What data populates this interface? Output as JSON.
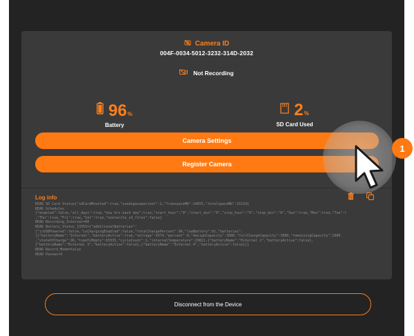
{
  "device": {
    "camera_id_label": "Camera ID",
    "camera_id_value": "004F-0034-5012-3232-314D-2032",
    "recording_status": "Not Recording"
  },
  "stats": {
    "battery": {
      "value": "96",
      "unit": "%",
      "label": "Battery"
    },
    "sd_card": {
      "value": "2",
      "unit": "%",
      "label": "SD Card Used"
    }
  },
  "buttons": {
    "camera_settings": "Camera Settings",
    "register_camera": "Register Camera",
    "disconnect": "Disconnect from the Device"
  },
  "log": {
    "title": "Log info",
    "lines": [
      "READ SD Card Status{\"sdCardMounted\":true,\"usedspacepercent\":2,\"freespaceMb\":14655,\"totalspaceMb\":15114}",
      "READ Schedules",
      "{\"enabled\":false,\"all_days\":true,\"how hrs each day\":true,\"start_hour\":\"0\",\"start_min\":\"0\",\"stop_hour\":\"0\",\"stop_min\":\"0\",\"Sun\":true,\"Mon\":true,\"Tue\":true,\"Wed\":true",
      ",\"Thu\":true,\"Fri\":true,\"Sat\":true,\"overwrite_sd_files\":false}",
      "READ Recording_Interval=60",
      "READ Battery_Status_13355={\"additionalBatteries\":",
      "[\"isUSBPowered\":false,\"isChargingEnabled\":false,\"totalChargePercent\":96,\"lowBattery\":0},\"batteries\":",
      "[{\"batteryName\":\"Internal\",\"batteryActive\":true,\"voltage\":4374,\"percent\":0,\"designCapacity\":3080,\"fullChargeCapacity\":3080,\"remainingCapacity\":2906",
      ",\"stateOfCharge\":96,\"timeToEmpty\":65535,\"cycleCount\":1,\"internalTemperature\":2982},{\"batteryName\":\"External 2\",\"batteryActive\":false},",
      "{\"batteryName\":\"External 3\",\"batteryActive\":false},{\"batteryName\":\"External 4\",\"batteryActive\":false}]}",
      "READ Record_Mode=false",
      "READ Password"
    ]
  },
  "overlay": {
    "step_number": "1"
  },
  "icons": {
    "camera": "camera-off-icon",
    "not_recording": "video-off-icon",
    "battery": "battery-icon",
    "sd_card": "sd-card-icon",
    "delete": "trash-icon",
    "copy": "copy-icon",
    "cursor": "mouse-pointer-icon"
  },
  "colors": {
    "accent": "#ff7a12",
    "background": "#232323",
    "card": "#3a3a3a"
  }
}
